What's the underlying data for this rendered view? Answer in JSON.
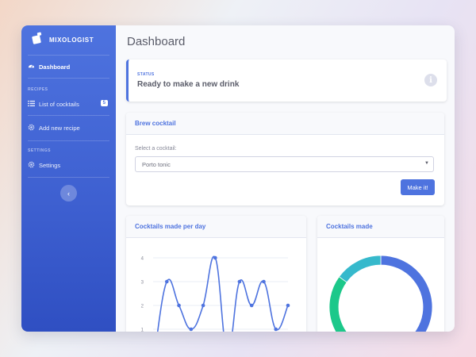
{
  "app": {
    "name": "MIXOLOGIST"
  },
  "sidebar": {
    "dashboard": "Dashboard",
    "recipes_heading": "RECIPES",
    "list_cocktails": "List of cocktails",
    "list_badge": "5",
    "add_recipe": "Add new recipe",
    "settings_heading": "SETTINGS",
    "settings": "Settings",
    "collapse_glyph": "‹"
  },
  "page": {
    "title": "Dashboard"
  },
  "status": {
    "label": "STATUS",
    "text": "Ready to make a new drink",
    "info_glyph": "i"
  },
  "brew": {
    "title": "Brew cocktail",
    "select_label": "Select a cocktail:",
    "selected": "Porto tonic",
    "button": "Make it!"
  },
  "charts": {
    "per_day_title": "Cocktails made per day",
    "made_title": "Cocktails made"
  },
  "chart_data": [
    {
      "type": "line",
      "title": "Cocktails made per day",
      "yticks": [
        1,
        2,
        3,
        4
      ],
      "ylim": [
        0,
        4.3
      ],
      "y": [
        0,
        3,
        2,
        1,
        2,
        4,
        0,
        3,
        2,
        3,
        1,
        2
      ],
      "color": "#4e73df"
    },
    {
      "type": "pie",
      "title": "Cocktails made",
      "values": [
        55,
        30,
        15
      ],
      "colors": [
        "#4e73df",
        "#1cc88a",
        "#36b9cc"
      ]
    }
  ]
}
